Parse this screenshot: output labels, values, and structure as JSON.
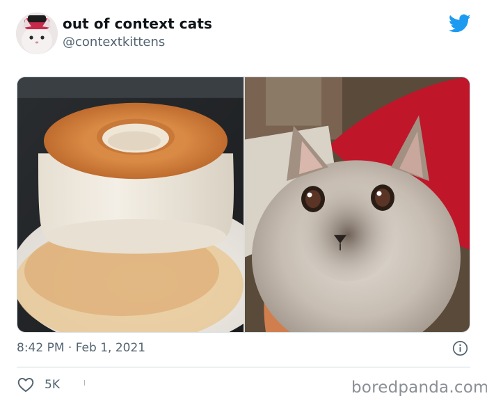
{
  "tweet": {
    "display_name": "out of context cats",
    "handle": "@contextkittens",
    "timestamp": "8:42 PM · Feb 1, 2021",
    "likes": "5K"
  },
  "media": {
    "images": [
      {
        "subject": "flan"
      },
      {
        "subject": "cat"
      }
    ]
  },
  "icons": {
    "brand": "twitter-bird-icon",
    "info": "info-icon",
    "like": "heart-icon"
  },
  "colors": {
    "twitter_blue": "#1d9bf0",
    "secondary_text": "#536471",
    "divider": "#cfd9de"
  },
  "watermark": "boredpanda.com"
}
